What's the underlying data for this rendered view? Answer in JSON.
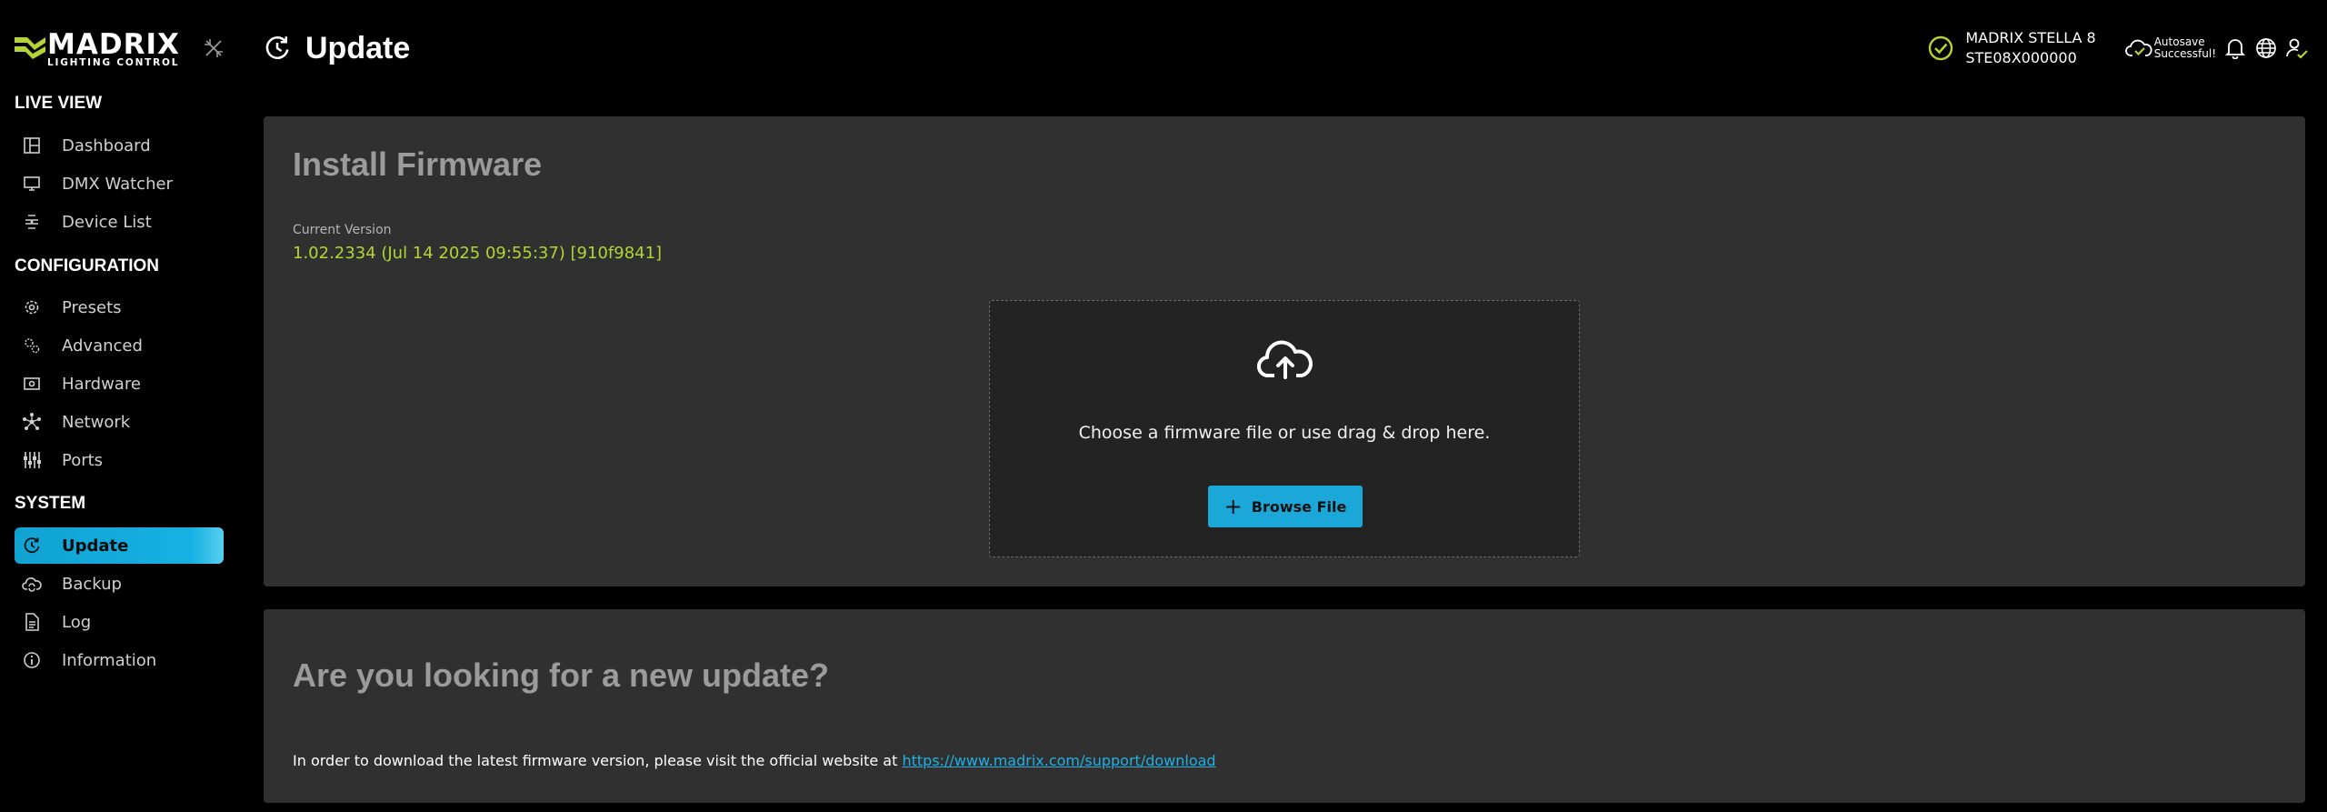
{
  "brand": {
    "name": "MADRIX",
    "tagline": "LIGHTING CONTROL",
    "accent_color": "#b5d334",
    "active_color": "#1ba8d8"
  },
  "sidebar": {
    "sections": [
      {
        "title": "LIVE VIEW",
        "items": [
          {
            "label": "Dashboard",
            "icon": "dashboard-icon"
          },
          {
            "label": "DMX Watcher",
            "icon": "monitor-icon"
          },
          {
            "label": "Device List",
            "icon": "device-list-icon"
          }
        ]
      },
      {
        "title": "CONFIGURATION",
        "items": [
          {
            "label": "Presets",
            "icon": "gear-icon"
          },
          {
            "label": "Advanced",
            "icon": "gears-icon"
          },
          {
            "label": "Hardware",
            "icon": "hardware-icon"
          },
          {
            "label": "Network",
            "icon": "network-icon"
          },
          {
            "label": "Ports",
            "icon": "ports-icon"
          }
        ]
      },
      {
        "title": "SYSTEM",
        "items": [
          {
            "label": "Update",
            "icon": "update-icon",
            "active": true
          },
          {
            "label": "Backup",
            "icon": "cloud-sync-icon"
          },
          {
            "label": "Log",
            "icon": "document-icon"
          },
          {
            "label": "Information",
            "icon": "info-icon"
          }
        ]
      }
    ]
  },
  "header": {
    "title": "Update",
    "device_name": "MADRIX STELLA 8",
    "device_serial": "STE08X000000",
    "autosave_line1": "Autosave",
    "autosave_line2": "Successful!"
  },
  "install": {
    "title": "Install Firmware",
    "version_label": "Current Version",
    "version_value": "1.02.2334 (Jul 14 2025 09:55:37) [910f9841]",
    "drop_text": "Choose a firmware file or use drag & drop here.",
    "browse_label": "Browse File"
  },
  "update_info": {
    "title": "Are you looking for a new update?",
    "text": "In order to download the latest firmware version, please visit the official website at ",
    "link_text": "https://www.madrix.com/support/download"
  }
}
